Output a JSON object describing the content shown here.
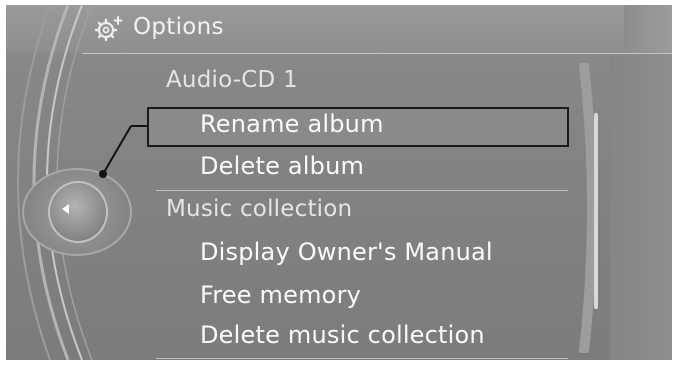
{
  "header": {
    "title": "Options",
    "icon": "options-gear-icon"
  },
  "menu": {
    "section1_label": "Audio-CD 1",
    "section1_items": [
      {
        "label": "Rename album",
        "selected": true
      },
      {
        "label": "Delete album",
        "selected": false
      }
    ],
    "section2_label": "Music collection",
    "section2_items": [
      {
        "label": "Display Owner's Manual"
      },
      {
        "label": "Free memory"
      },
      {
        "label": "Delete music collection"
      }
    ]
  },
  "controller": {
    "icon": "left-arrow-icon"
  },
  "colors": {
    "background": "#858585",
    "text": "#fafafa",
    "selection_border": "#1a1a1a"
  }
}
